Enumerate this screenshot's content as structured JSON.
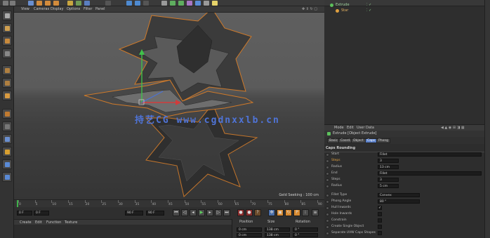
{
  "viewport_menu": [
    "View",
    "Cameras",
    "Display",
    "Filter",
    "Panel"
  ],
  "viewport_label": "Geld Seeking : 100 cm",
  "watermark": "持艺CG www.cgdnxxlb.cn",
  "timeline": {
    "ticks": [
      "0",
      "5",
      "10",
      "15",
      "20",
      "25",
      "30",
      "35",
      "40",
      "45",
      "50",
      "55",
      "60",
      "65",
      "70",
      "75",
      "80",
      "85",
      "90"
    ],
    "frame_end_marker": "0 F"
  },
  "transport": {
    "start_frame": "0 F",
    "current_frame": "0 F",
    "end_frame": "90 F",
    "fps_field": "90 F"
  },
  "material_menu": [
    "Create",
    "Edit",
    "Function",
    "Texture"
  ],
  "coords": {
    "headers": [
      "Position",
      "Size",
      "Rotation"
    ],
    "rows": [
      [
        "0 cm",
        "138 cm",
        "0 °"
      ],
      [
        "0 cm",
        "138 cm",
        "0 °"
      ]
    ]
  },
  "objects": [
    {
      "name": "Extrude",
      "color": "#5cc05c"
    },
    {
      "name": "Star",
      "color": "#e0a040"
    }
  ],
  "attr_menu": [
    "Mode",
    "Edit",
    "User Data"
  ],
  "attr_title": "Extrude [Object Extrude]",
  "attr_tabs": [
    "Basic",
    "Coord.",
    "Object",
    "Caps",
    "Phong"
  ],
  "attr_section": "Caps Rounding",
  "properties": [
    {
      "label": "Start",
      "value": "Fillet",
      "kind": "wide"
    },
    {
      "label": "Steps",
      "value": "3",
      "kind": "short"
    },
    {
      "label": "Radius",
      "value": "13 cm",
      "kind": "short"
    },
    {
      "label": "End",
      "value": "Fillet",
      "kind": "wide"
    },
    {
      "label": "Steps",
      "value": "3",
      "kind": "short"
    },
    {
      "label": "Radius",
      "value": "5 cm",
      "kind": "short"
    },
    {
      "label": "Fillet Type",
      "value": "Convex",
      "kind": "mid"
    },
    {
      "label": "Phong Angle",
      "value": "80 °",
      "kind": "mid"
    },
    {
      "label": "Hull Inwards",
      "value": "✓",
      "kind": "check"
    },
    {
      "label": "Hole Inwards",
      "value": "",
      "kind": "check"
    },
    {
      "label": "Constrain",
      "value": "",
      "kind": "check"
    },
    {
      "label": "Create Single Object",
      "value": "",
      "kind": "check"
    },
    {
      "label": "Separate UVW Caps Shapes",
      "value": "",
      "kind": "check"
    }
  ]
}
